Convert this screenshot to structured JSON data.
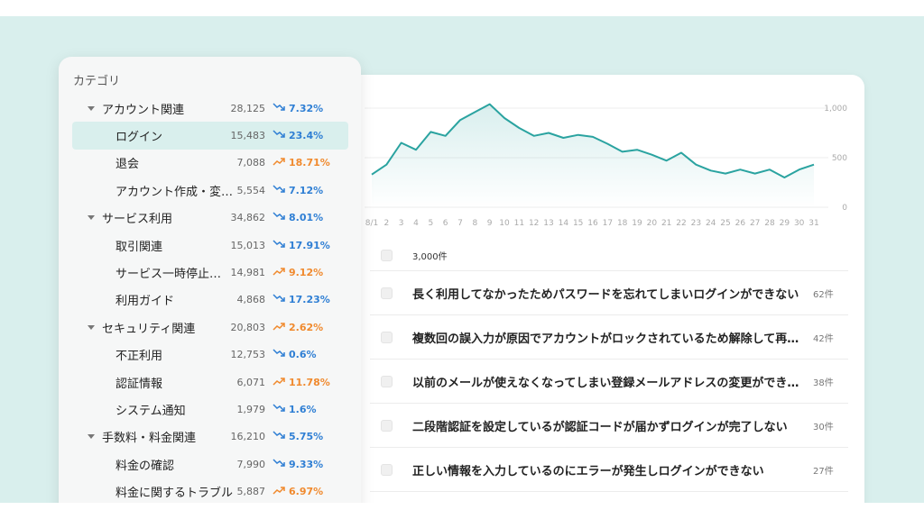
{
  "category_panel": {
    "title": "カテゴリ",
    "items": [
      {
        "name": "アカウント関連",
        "level": "parent",
        "count": "28,125",
        "trend": "down",
        "pct": "7.32%"
      },
      {
        "name": "ログイン",
        "level": "child",
        "selected": true,
        "count": "15,483",
        "trend": "down",
        "pct": "23.4%"
      },
      {
        "name": "退会",
        "level": "child",
        "count": "7,088",
        "trend": "up",
        "pct": "18.71%"
      },
      {
        "name": "アカウント作成・変…",
        "level": "child",
        "count": "5,554",
        "trend": "down",
        "pct": "7.12%"
      },
      {
        "name": "サービス利用",
        "level": "parent",
        "count": "34,862",
        "trend": "down",
        "pct": "8.01%"
      },
      {
        "name": "取引関連",
        "level": "child",
        "count": "15,013",
        "trend": "down",
        "pct": "17.91%"
      },
      {
        "name": "サービス一時停止…",
        "level": "child",
        "count": "14,981",
        "trend": "up",
        "pct": "9.12%"
      },
      {
        "name": "利用ガイド",
        "level": "child",
        "count": "4,868",
        "trend": "down",
        "pct": "17.23%"
      },
      {
        "name": "セキュリティ関連",
        "level": "parent",
        "count": "20,803",
        "trend": "up",
        "pct": "2.62%"
      },
      {
        "name": "不正利用",
        "level": "child",
        "count": "12,753",
        "trend": "down",
        "pct": "0.6%"
      },
      {
        "name": "認証情報",
        "level": "child",
        "count": "6,071",
        "trend": "up",
        "pct": "11.78%"
      },
      {
        "name": "システム通知",
        "level": "child",
        "count": "1,979",
        "trend": "down",
        "pct": "1.6%"
      },
      {
        "name": "手数料・料金関連",
        "level": "parent",
        "count": "16,210",
        "trend": "down",
        "pct": "5.75%"
      },
      {
        "name": "料金の確認",
        "level": "child",
        "count": "7,990",
        "trend": "down",
        "pct": "9.33%"
      },
      {
        "name": "料金に関するトラブル",
        "level": "child",
        "count": "5,887",
        "trend": "up",
        "pct": "6.97%"
      }
    ]
  },
  "colors": {
    "trend_down": "#2f7fd4",
    "trend_up": "#f08a2e",
    "line": "#2aa3a0",
    "selected_bg": "#d9efed"
  },
  "chart_data": {
    "type": "area",
    "x": [
      "8/1",
      "2",
      "3",
      "4",
      "5",
      "6",
      "7",
      "8",
      "9",
      "10",
      "11",
      "12",
      "13",
      "14",
      "15",
      "16",
      "17",
      "18",
      "19",
      "20",
      "21",
      "22",
      "23",
      "24",
      "25",
      "26",
      "27",
      "28",
      "29",
      "30",
      "31"
    ],
    "values": [
      330,
      430,
      650,
      580,
      760,
      720,
      880,
      960,
      1040,
      900,
      800,
      720,
      750,
      700,
      730,
      710,
      640,
      560,
      580,
      530,
      470,
      550,
      430,
      370,
      340,
      380,
      340,
      380,
      300,
      380,
      430
    ],
    "ylim": [
      0,
      1000
    ],
    "y_ticks": [
      "1,000",
      "500",
      "0"
    ],
    "grid": true
  },
  "list": {
    "total": "3,000件",
    "rows": [
      {
        "text": "長く利用してなかったためパスワードを忘れてしまいログインができない",
        "count": "62件"
      },
      {
        "text": "複数回の誤入力が原因でアカウントがロックされているため解除して再…",
        "count": "42件"
      },
      {
        "text": "以前のメールが使えなくなってしまい登録メールアドレスの変更ができ…",
        "count": "38件"
      },
      {
        "text": "二段階認証を設定しているが認証コードが届かずログインが完了しない",
        "count": "30件"
      },
      {
        "text": "正しい情報を入力しているのにエラーが発生しログインができない",
        "count": "27件"
      }
    ]
  }
}
